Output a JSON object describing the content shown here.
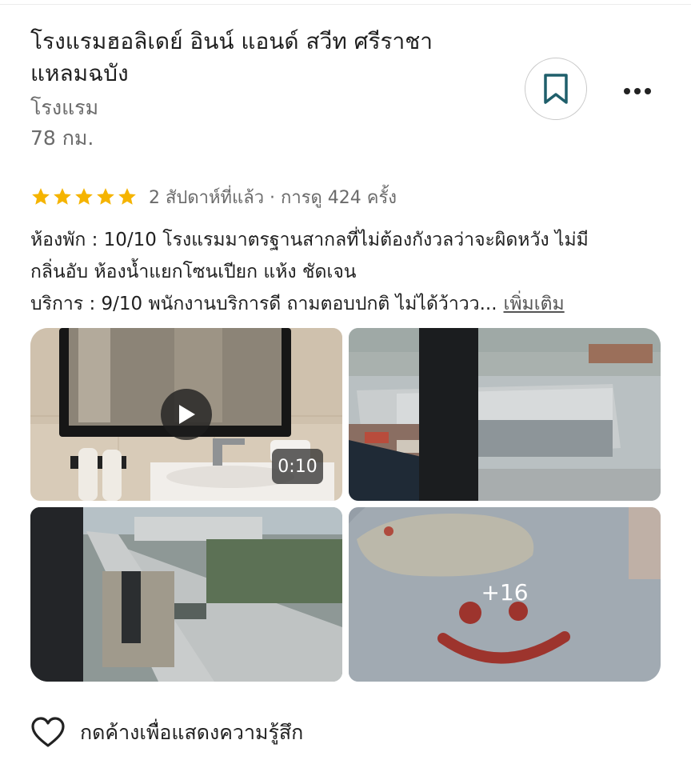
{
  "listing": {
    "title_line1": "โรงแรมฮอลิเดย์ อินน์ แอนด์ สวีท ศรีราชา",
    "title_line2": "แหลมฉบัง",
    "category": "โรงแรม",
    "distance": "78 กม."
  },
  "actions": {
    "bookmark_icon": "bookmark-icon",
    "more_icon": "more-horizontal-icon"
  },
  "rating": {
    "stars": 5,
    "max_stars": 5,
    "star_color": "#f5b400",
    "meta": "2 สัปดาห์ที่แล้ว · การดู 424 ครั้ง"
  },
  "review": {
    "line1": "ห้องพัก : 10/10 โรงแรมมาตรฐานสากลที่ไม่ต้องกังวลว่าจะผิดหวัง ไม่มี",
    "line2": "กลิ่นอับ ห้องน้ำแยกโซนเปียก แห้ง ชัดเจน",
    "line3": "บริการ : 9/10 พนักงานบริการดี ถามตอบปกติ ไม่ได้ว้าวว...",
    "more_label": "เพิ่มเติม"
  },
  "photos": {
    "video_duration": "0:10",
    "more_count": "+16"
  },
  "reaction": {
    "icon": "heart-outline-icon",
    "label": "กดค้างเพื่อแสดงความรู้สึก"
  },
  "colors": {
    "bookmark": "#1f5f6b",
    "text_primary": "#1f1f1f",
    "text_secondary": "#6b6b6b"
  }
}
